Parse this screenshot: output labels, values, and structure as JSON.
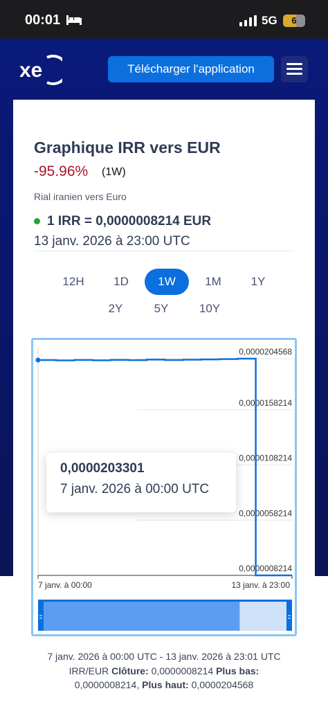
{
  "status_bar": {
    "time": "00:01",
    "network": "5G",
    "battery": "6",
    "battery_level": 0.6
  },
  "header": {
    "download_label": "Télécharger l'application",
    "logo_text": "xe"
  },
  "converter": {
    "title": "Graphique IRR vers EUR",
    "change": "-95.96%",
    "period_label": "(1W)",
    "subtitle": "Rial iranien vers Euro",
    "rate": "1 IRR = 0,0000008214 EUR",
    "rate_date": "13 janv. 2026 à 23:00 UTC"
  },
  "periods": {
    "row1": [
      "12H",
      "1D",
      "1W",
      "1M",
      "1Y"
    ],
    "row2": [
      "2Y",
      "5Y",
      "10Y"
    ],
    "active": "1W"
  },
  "tooltip": {
    "value": "0,0000203301",
    "date": "7 janv. 2026 à 00:00 UTC"
  },
  "chart_data": {
    "type": "line",
    "y_tick_labels": [
      "0,0000204568",
      "0,0000158214",
      "0,0000108214",
      "0,0000058214",
      "0,0000008214"
    ],
    "y_ticks": [
      2.04568e-05,
      1.58214e-05,
      1.08214e-05,
      5.8214e-06,
      8.214e-07
    ],
    "ylim": [
      8.214e-07,
      2.04568e-05
    ],
    "x_tick_labels": [
      "7 janv. à 00:00",
      "13 janv. à 23:00"
    ],
    "x": [
      0,
      0.5,
      1,
      1.5,
      2,
      2.5,
      3,
      3.5,
      4,
      4.5,
      5,
      5.5,
      6,
      6.5,
      7
    ],
    "x_units": "days since 7 janv. 2026 00:00 UTC",
    "series": [
      {
        "values": [
          2.03301e-05,
          2.03e-05,
          2.034e-05,
          2.031e-05,
          2.035e-05,
          2.032e-05,
          2.037e-05,
          2.033e-05,
          2.036e-05,
          2.039e-05,
          2.042e-05,
          2.04568e-05,
          8.214e-07,
          8.214e-07,
          8.214e-07
        ]
      }
    ],
    "grid": true,
    "color": "#0c6fde"
  },
  "summary": {
    "line1": "7 janv. 2026 à 00:00 UTC - 13 janv. 2026 à 23:01 UTC",
    "pair": "IRR/EUR",
    "close_label": "Clôture:",
    "close_value": "0,0000008214",
    "low_label": "Plus bas:",
    "low_value": "0,0000008214",
    "high_label": "Plus haut:",
    "high_value": "0,0000204568"
  }
}
